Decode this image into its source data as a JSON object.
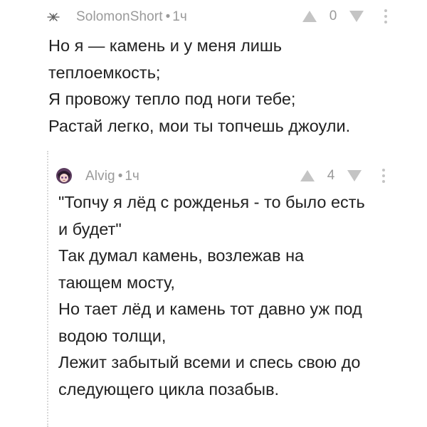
{
  "comments": [
    {
      "username": "SolomonShort",
      "separator": "•",
      "time": "1ч",
      "score": "0",
      "lines": [
        "Но я — камень и у меня лишь",
        "теплоемкость;",
        "Я провожу тепло под ноги тебе;",
        "Растай легко, мои ты топчешь джоули."
      ]
    },
    {
      "username": "Alvig",
      "separator": "•",
      "time": "1ч",
      "score": "4",
      "lines": [
        "\"Топчу я лёд с рожденья - то было есть",
        "и будет\"",
        "Так думал камень, возлежав на",
        "тающем мосту,",
        "Но тает лёд и камень тот давно уж под",
        "водою толщи,",
        "Лежит забытый всеми и спесь свою до",
        "следующего цикла позабыв."
      ]
    }
  ],
  "icons": {
    "avatar_1": "sparkle-avatar-icon",
    "avatar_2": "anime-avatar-icon",
    "upvote": "triangle-up-icon",
    "downvote": "triangle-down-icon",
    "more": "vertical-dots-icon"
  },
  "colors": {
    "text": "#222222",
    "meta": "#9a9a9a",
    "icon": "#c4c4c4"
  }
}
